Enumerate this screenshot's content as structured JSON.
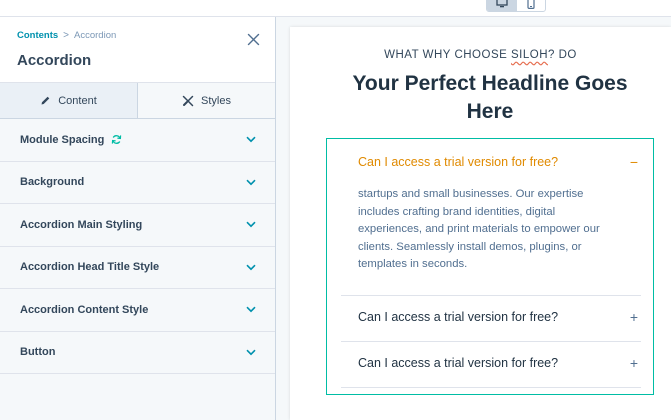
{
  "colors": {
    "accent": "#0091ae",
    "teal": "#00bda5",
    "orange": "#e08a00",
    "text": "#33475b"
  },
  "toolbar": {
    "desktop_icon": "desktop-icon",
    "mobile_icon": "mobile-icon"
  },
  "sidebar": {
    "breadcrumb": {
      "parent": "Contents",
      "separator": ">",
      "current": "Accordion"
    },
    "title": "Accordion",
    "close_icon": "close-icon",
    "tabs": [
      {
        "label": "Content",
        "icon": "pencil-icon"
      },
      {
        "label": "Styles",
        "icon": "brush-icon"
      }
    ],
    "sections": [
      {
        "label": "Module Spacing",
        "icon": "sync-icon"
      },
      {
        "label": "Background"
      },
      {
        "label": "Accordion Main Styling"
      },
      {
        "label": "Accordion Head Title Style"
      },
      {
        "label": "Accordion Content Style"
      },
      {
        "label": "Button"
      }
    ]
  },
  "preview": {
    "eyebrow_prefix": "WHAT WHY CHOOSE ",
    "eyebrow_brand": "SILOH",
    "eyebrow_suffix": "? DO",
    "headline": "Your Perfect Headline Goes Here",
    "accordion": [
      {
        "question": "Can I access a trial version for free?",
        "sign": "−",
        "answer": "startups and small businesses. Our expertise includes crafting brand identities, digital experiences, and print materials to empower our clients. Seamlessly install demos, plugins, or templates in seconds."
      },
      {
        "question": "Can I access a trial version for free?",
        "sign": "+"
      },
      {
        "question": "Can I access a trial version for free?",
        "sign": "+"
      }
    ]
  }
}
